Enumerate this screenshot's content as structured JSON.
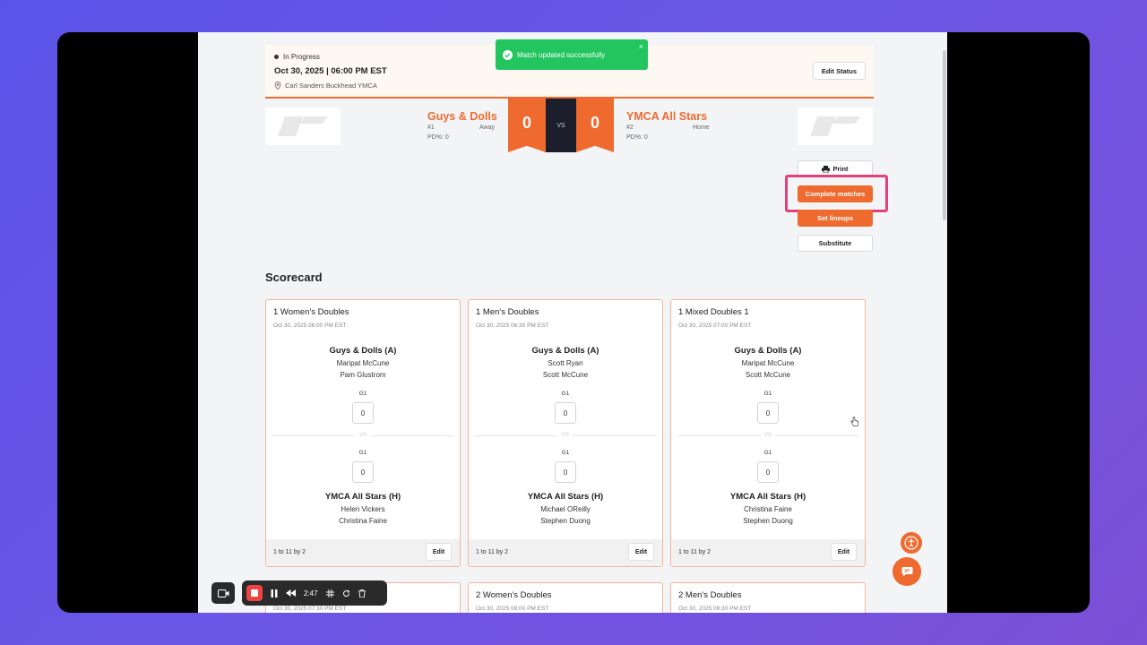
{
  "toast": {
    "message": "Match updated successfully",
    "close": "×"
  },
  "match": {
    "status": "In Progress",
    "datetime": "Oct 30, 2025 | 06:00 PM EST",
    "location": "Carl Sanders Buckhead YMCA",
    "edit_status_label": "Edit Status",
    "vs_label": "VS"
  },
  "away": {
    "name": "Guys & Dolls",
    "rank": "#1",
    "side": "Away",
    "pd": "PD%: 0",
    "score": "0"
  },
  "home": {
    "name": "YMCA All Stars",
    "rank": "#2",
    "side": "Home",
    "pd": "PD%: 0",
    "score": "0"
  },
  "actions": {
    "print": "Print",
    "complete": "Complete matches",
    "lineups": "Set lineups",
    "substitute": "Substitute"
  },
  "scorecard": {
    "title": "Scorecard",
    "cards": [
      {
        "title": "1 Women's Doubles",
        "date": "Oct 30, 2025 06:00 PM EST",
        "team_a": "Guys & Dolls (A)",
        "a_players": [
          "Maripat McCune",
          "Pam Glustrom"
        ],
        "game_label_a": "G1",
        "score_a": "0",
        "vs": "VS",
        "game_label_b": "G1",
        "score_b": "0",
        "team_b": "YMCA All Stars (H)",
        "b_players": [
          "Helen Vickers",
          "Christina Faine"
        ],
        "format": "1 to 11 by 2",
        "edit": "Edit"
      },
      {
        "title": "1 Men's Doubles",
        "date": "Oct 30, 2025 06:30 PM EST",
        "team_a": "Guys & Dolls (A)",
        "a_players": [
          "Scott Ryan",
          "Scott McCune"
        ],
        "game_label_a": "G1",
        "score_a": "0",
        "vs": "VS",
        "game_label_b": "G1",
        "score_b": "0",
        "team_b": "YMCA All Stars (H)",
        "b_players": [
          "Michael OReilly",
          "Stephen Duong"
        ],
        "format": "1 to 11 by 2",
        "edit": "Edit"
      },
      {
        "title": "1 Mixed Doubles 1",
        "date": "Oct 30, 2025 07:00 PM EST",
        "team_a": "Guys & Dolls (A)",
        "a_players": [
          "Maripat McCune",
          "Scott McCune"
        ],
        "game_label_a": "G1",
        "score_a": "0",
        "vs": "VS",
        "game_label_b": "G1",
        "score_b": "0",
        "team_b": "YMCA All Stars (H)",
        "b_players": [
          "Christina Faine",
          "Stephen Duong"
        ],
        "format": "1 to 11 by 2",
        "edit": "Edit"
      },
      {
        "title": "",
        "date": "Oct 30, 2025 07:30 PM EST"
      },
      {
        "title": "2 Women's Doubles",
        "date": "Oct 30, 2025 08:00 PM EST"
      },
      {
        "title": "2 Men's Doubles",
        "date": "Oct 30, 2025 08:30 PM EST"
      }
    ]
  },
  "recorder": {
    "time": "2:47"
  },
  "colors": {
    "accent": "#ee6a2f",
    "toast": "#22c55e",
    "highlight": "#e2407a",
    "dark": "#1c1f2b"
  }
}
